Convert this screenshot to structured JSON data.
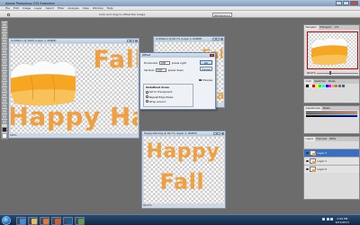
{
  "window": {
    "title": "Adobe Photoshop CS3 Extended"
  },
  "menu": [
    "File",
    "Edit",
    "Image",
    "Layer",
    "Select",
    "Filter",
    "Analysis",
    "View",
    "Window",
    "Help"
  ],
  "options_bar": {
    "hint": "Click and drag to offset the image",
    "workspace": "Workspace ▾"
  },
  "documents": {
    "left": {
      "title": "Untitled-1 @ 100% (Layer 1, RGB/8)",
      "status": "100%",
      "text": "Fall",
      "text2": "Happy Hal"
    },
    "back": {
      "title": "Untitled-2 @ 66.7% (Layer 1, RGB/8)",
      "text": "Fall",
      "text2": "Hal"
    },
    "bottom": {
      "title": "Happy-fall-blog @ 66.7% (Layer 2, RGB/8)",
      "status": "66.67%",
      "text1": "Happy",
      "text2": "Fall"
    }
  },
  "dialog": {
    "title": "Offset",
    "horizontal_label": "Horizontal:",
    "horizontal_value": "200",
    "horizontal_unit": "pixels right",
    "vertical_label": "Vertical:",
    "vertical_value": "100",
    "vertical_unit": "pixels down",
    "group_label": "Undefined Areas",
    "opt1": "Set to Transparent",
    "opt2": "Repeat Edge Pixels",
    "opt3": "Wrap Around",
    "ok": "OK",
    "cancel": "Cancel",
    "preview": "Preview"
  },
  "panels": {
    "nav_tabs": [
      "Navigator",
      "Histogram",
      "Info"
    ],
    "color_tabs": [
      "Color",
      "Swatches",
      "Styles"
    ],
    "adjust_tabs": [
      "Adjustments",
      "Masks"
    ],
    "layers_tabs": [
      "Layers",
      "Channels",
      "Paths"
    ],
    "zoom_value": "66.67%",
    "layers": [
      "Layer 2",
      "Layer 1",
      "Layer 0"
    ]
  },
  "taskbar": {
    "time": "2:09 PM",
    "date": "9/21/2011"
  },
  "colors": {
    "accent": "#f0a040",
    "titlebar": "#7e9cbd",
    "taskbar": "#1a3658"
  }
}
